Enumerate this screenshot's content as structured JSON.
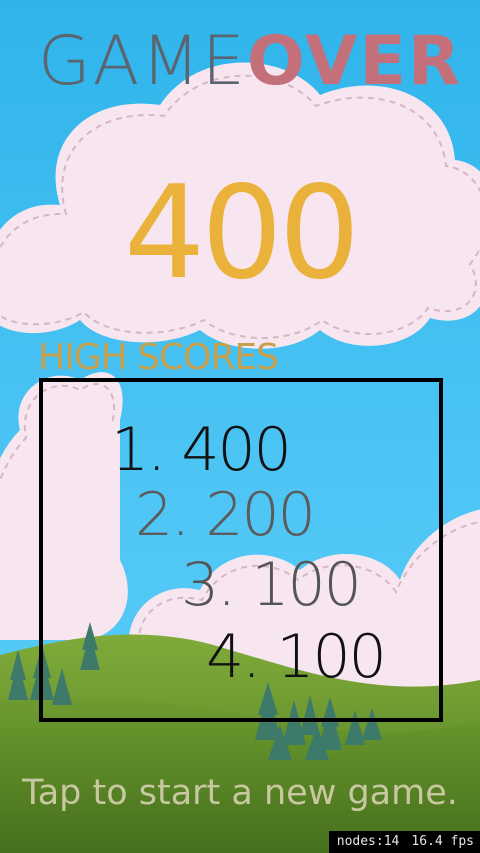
{
  "title": {
    "word1": "GAME",
    "word2": "OVER"
  },
  "score": "400",
  "high_scores": {
    "title": "HIGH SCORES",
    "rows": [
      {
        "text": "1. 400",
        "color": "#111111"
      },
      {
        "text": "2. 200",
        "color": "#5b5b5b"
      },
      {
        "text": "3. 100",
        "color": "#555555"
      },
      {
        "text": "4. 100",
        "color": "#111111"
      }
    ]
  },
  "hint": "Tap to start a new game.",
  "debug": {
    "nodes": "nodes:14",
    "fps": "16.4 fps"
  },
  "colors": {
    "sky": "#3fbdf0",
    "cloud": "#f7e6ef",
    "hill": "#6a9a30",
    "score": "#eab23a",
    "game_word": "#5a6570",
    "over_word": "#c4707a",
    "high_scores_title": "#c6a04c"
  }
}
